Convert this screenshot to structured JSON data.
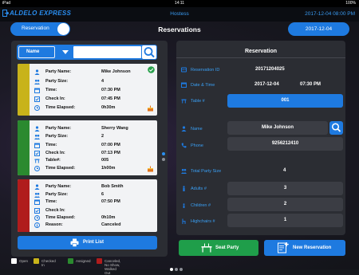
{
  "statusbar": {
    "device": "iPad",
    "time": "14:11",
    "battery": "100%"
  },
  "header": {
    "brand": "ALDELO EXPRESS",
    "user": "Hostess",
    "datetime": "2017-12-04 08:00 PM"
  },
  "toolbar": {
    "mode_label": "Reservation",
    "title": "Reservations",
    "date": "2017-12-04"
  },
  "filter": {
    "field": "Name",
    "search_value": ""
  },
  "reservations": [
    {
      "status_color": "#c8b31a",
      "rows": [
        {
          "label": "Party Name:",
          "value": "Mike Johnson"
        },
        {
          "label": "Party Size:",
          "value": "4"
        },
        {
          "label": "Time:",
          "value": "07:30 PM"
        },
        {
          "label": "Check In:",
          "value": "07:45 PM"
        },
        {
          "label": "Time Elapsed:",
          "value": "0h30m"
        }
      ]
    },
    {
      "status_color": "#2b8a2f",
      "rows": [
        {
          "label": "Party Name:",
          "value": "Sherry Wang"
        },
        {
          "label": "Party Size:",
          "value": "2"
        },
        {
          "label": "Time:",
          "value": "07:00 PM"
        },
        {
          "label": "Check In:",
          "value": "07:13 PM"
        },
        {
          "label": "Table#:",
          "value": "005"
        },
        {
          "label": "Time Elapsed:",
          "value": "1h00m"
        }
      ]
    },
    {
      "status_color": "#b01c1c",
      "rows": [
        {
          "label": "Party Name:",
          "value": "Bob Smith"
        },
        {
          "label": "Party Size:",
          "value": "6"
        },
        {
          "label": "Time:",
          "value": "07:50 PM"
        },
        {
          "label": "Check In:",
          "value": ""
        },
        {
          "label": "Time Elapsed:",
          "value": "0h10m"
        },
        {
          "label": "Reason:",
          "value": "Canceled"
        }
      ]
    }
  ],
  "print_label": "Print List",
  "detail": {
    "title": "Reservation",
    "reservation_id_label": "Reservation ID",
    "reservation_id": "20171204025",
    "datetime_label": "Date & Time",
    "date": "2017-12-04",
    "time": "07:30 PM",
    "table_label": "Table #",
    "table": "001",
    "name_label": "Name",
    "name": "Mike Johnson",
    "phone_label": "Phone",
    "phone": "9256212410",
    "total_label": "Total Party Size",
    "total": "4",
    "adults_label": "Adults #",
    "adults": "3",
    "children_label": "Children #",
    "children": "2",
    "highchairs_label": "Highchairs #",
    "highchairs": "1"
  },
  "actions": {
    "seat_label": "Seat Party",
    "new_label": "New Reservation"
  },
  "legend": [
    {
      "label": "Open",
      "color": "#ffffff"
    },
    {
      "label": "Checked In",
      "color": "#c8b31a"
    },
    {
      "label": "Assigned",
      "color": "#2b8a2f"
    },
    {
      "label": "Canceled, No Show, Walked Out",
      "color": "#b01c1c"
    }
  ],
  "colors": {
    "accent": "#1e7ae0",
    "success": "#1f9e4a"
  }
}
